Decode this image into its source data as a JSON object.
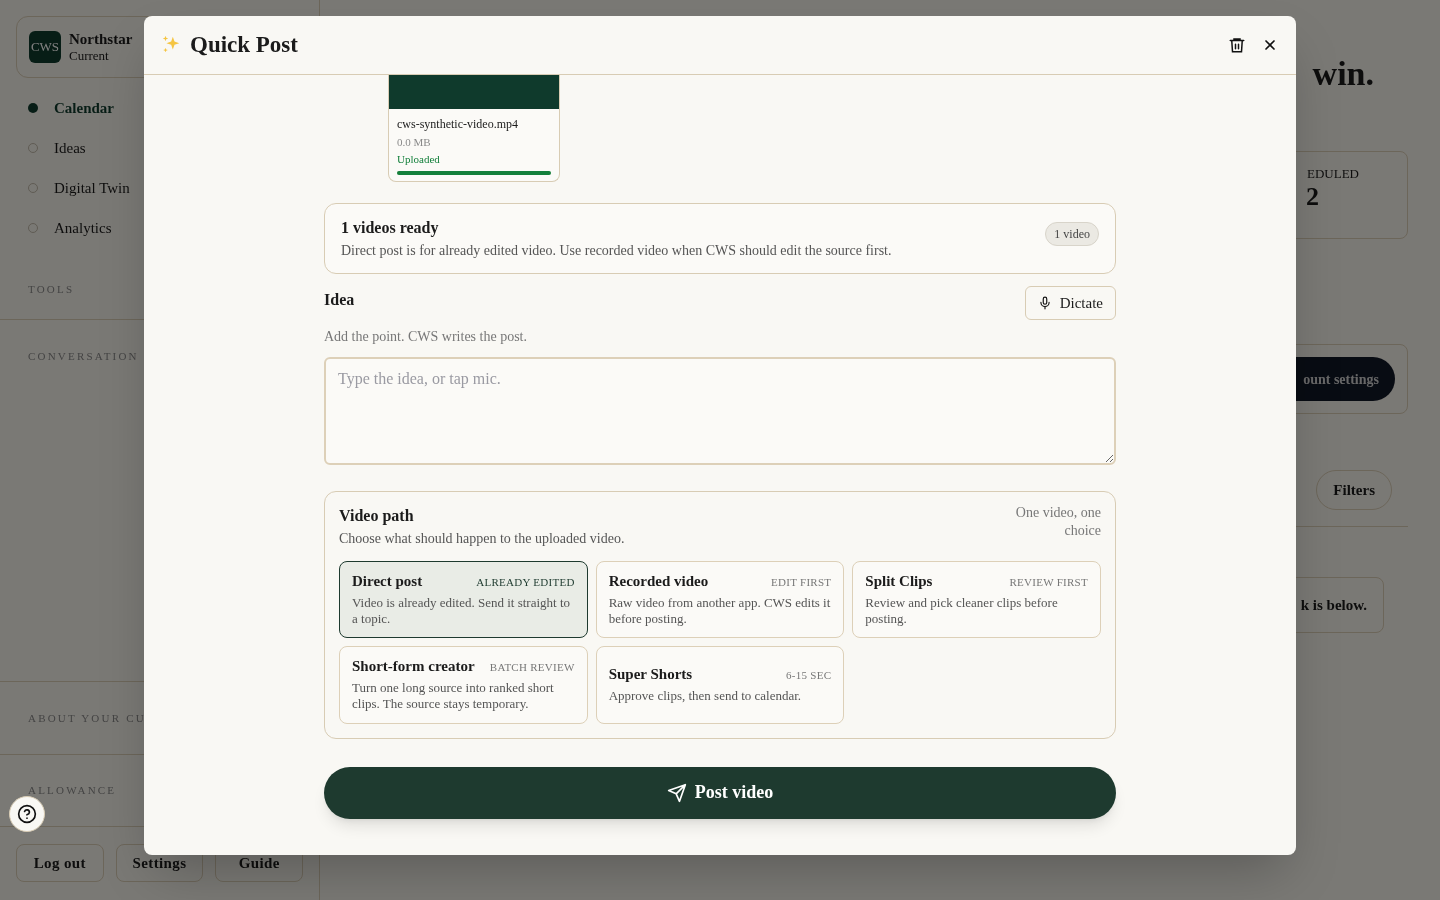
{
  "sidebar": {
    "workspace": {
      "logo": "CWS",
      "name": "Northstar",
      "sub": "Current"
    },
    "nav": [
      {
        "label": "Calendar",
        "selected": true
      },
      {
        "label": "Ideas",
        "selected": false
      },
      {
        "label": "Digital Twin",
        "selected": false
      },
      {
        "label": "Analytics",
        "selected": false
      }
    ],
    "sections": [
      "TOOLS",
      "CONVERSATION",
      "ABOUT YOUR CU",
      "ALLOWANCE"
    ],
    "footer_buttons": [
      "Log out",
      "Settings",
      "Guide"
    ]
  },
  "main": {
    "heading": "win.",
    "stat": {
      "label": "EDULED",
      "value": "2"
    },
    "settings_button": "ount settings",
    "filters_button": "Filters",
    "notice": "k is below."
  },
  "modal": {
    "title": "Quick Post",
    "upload": {
      "file_name": "cws-synthetic-video.mp4",
      "size": "0.0 MB",
      "status": "Uploaded",
      "level": 1
    },
    "ready": {
      "title": "1 videos ready",
      "text": "Direct post is for already edited video. Use recorded video when CWS should edit the source first.",
      "badge": "1 video"
    },
    "idea": {
      "label": "Idea",
      "dictate_button": "Dictate",
      "hint": "Add the point. CWS writes the post.",
      "placeholder": "Type the idea, or tap mic."
    },
    "video_path": {
      "title": "Video path",
      "subtitle": "Choose what should happen to the uploaded video.",
      "note": "One video, one choice",
      "options": [
        {
          "title": "Direct post",
          "tag": "ALREADY EDITED",
          "description": "Video is already edited. Send it straight to a topic.",
          "selected": true
        },
        {
          "title": "Recorded video",
          "tag": "EDIT FIRST",
          "description": "Raw video from another app. CWS edits it before posting.",
          "selected": false
        },
        {
          "title": "Split Clips",
          "tag": "REVIEW FIRST",
          "description": "Review and pick cleaner clips before posting.",
          "selected": false
        },
        {
          "title": "Short-form creator",
          "tag": "BATCH REVIEW",
          "description": "Turn one long source into ranked short clips. The source stays temporary.",
          "selected": false
        },
        {
          "title": "Super Shorts",
          "tag": "6-15 SEC",
          "description": "Approve clips, then send to calendar.",
          "selected": false
        }
      ]
    },
    "submit_button": "Post video"
  }
}
